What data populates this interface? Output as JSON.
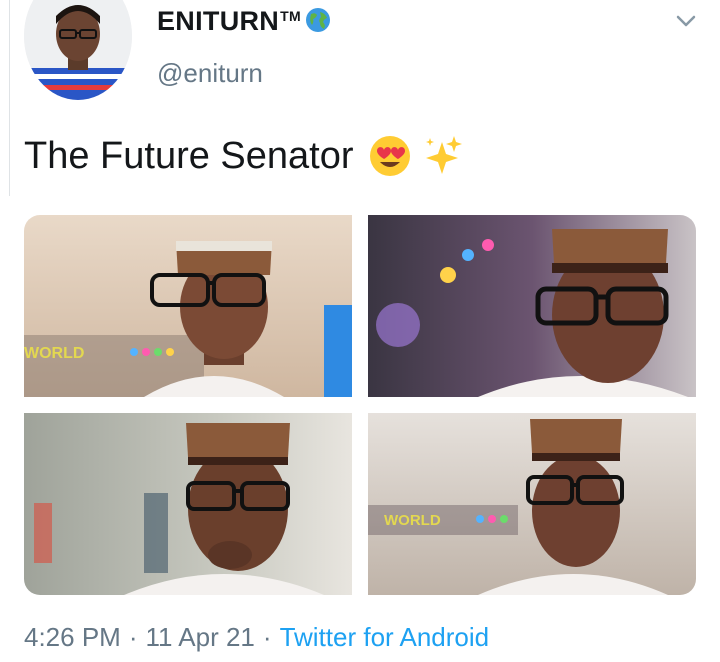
{
  "tweet": {
    "display_name": "ENITURN",
    "trademark": "TM",
    "verified_icon": "globe-emoji-icon",
    "handle": "@eniturn",
    "text": "The Future Senator",
    "emojis": [
      "heart-eyes-emoji-icon",
      "sparkles-emoji-icon"
    ],
    "time": "4:26 PM",
    "separator": "·",
    "date": "11 Apr 21",
    "source": "Twitter for Android"
  },
  "media": [
    {
      "name": "photo-1",
      "overlay_text": "WORLD"
    },
    {
      "name": "photo-2",
      "overlay_text": ""
    },
    {
      "name": "photo-3",
      "overlay_text": ""
    },
    {
      "name": "photo-4",
      "overlay_text": "WORLD"
    }
  ],
  "colors": {
    "text": "#14171a",
    "secondary": "#657786",
    "link": "#1da1f2"
  }
}
